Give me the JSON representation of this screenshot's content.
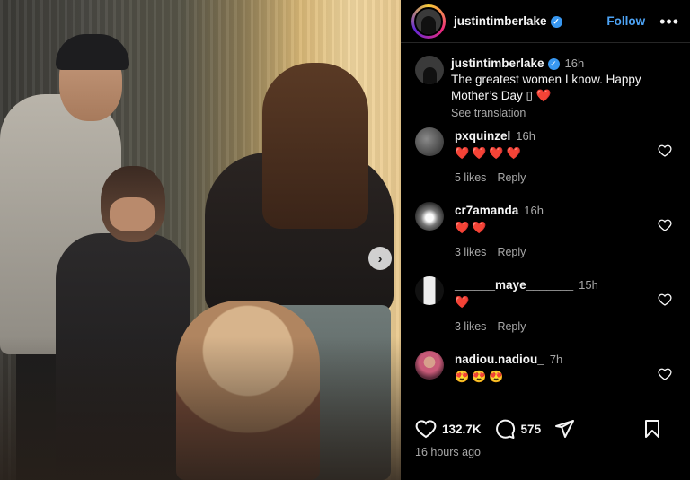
{
  "header": {
    "username": "justintimberlake",
    "verified_icon": "verified-badge-icon",
    "follow_label": "Follow",
    "more_label": "•••"
  },
  "photo": {
    "next_label": "›"
  },
  "caption": {
    "username": "justintimberlake",
    "time": "16h",
    "text": "The greatest women I know. Happy Mother’s Day ▯",
    "heart": "❤️",
    "see_translation": "See translation"
  },
  "comments": [
    {
      "username": "pxquinzel",
      "time": "16h",
      "text": "❤️❤️❤️❤️",
      "likes": "5 likes",
      "reply": "Reply"
    },
    {
      "username": "cr7amanda",
      "time": "16h",
      "text": "❤️❤️",
      "likes": "3 likes",
      "reply": "Reply"
    },
    {
      "username": "______maye_______",
      "time": "15h",
      "text": "❤️",
      "likes": "3 likes",
      "reply": "Reply"
    },
    {
      "username": "nadiou.nadiou_",
      "time": "7h",
      "text": "😍😍😍",
      "likes": "",
      "reply": ""
    }
  ],
  "actions": {
    "likes_count": "132.7K",
    "comments_count": "575",
    "posted": "16 hours ago"
  },
  "colors": {
    "accent": "#4da3f5",
    "verified": "#3897f0",
    "background": "#000000",
    "muted": "#a8a8a8"
  }
}
